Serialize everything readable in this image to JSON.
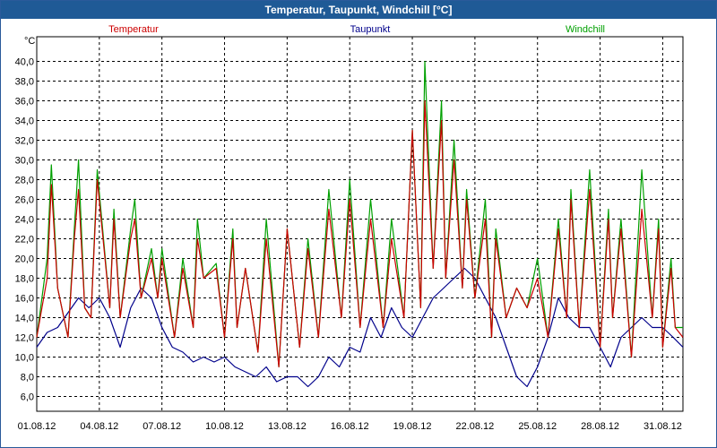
{
  "window": {
    "title": "Temperatur, Taupunkt, Windchill [°C]"
  },
  "colors": {
    "titlebar": "#1f5a96",
    "temperatur": "#cc0000",
    "taupunkt": "#00008b",
    "windchill": "#00a000"
  },
  "chart_data": {
    "type": "line",
    "title": "Temperatur, Taupunkt, Windchill [°C]",
    "ylabel": "°C",
    "xlabel": "",
    "ylim": [
      4.5,
      42.5
    ],
    "xlim": [
      0,
      30.97
    ],
    "x_start_label": "01.08.12",
    "grid": true,
    "legend_placement": "top",
    "yticks": [
      "6,0",
      "8,0",
      "10,0",
      "12,0",
      "14,0",
      "16,0",
      "18,0",
      "20,0",
      "22,0",
      "24,0",
      "26,0",
      "28,0",
      "30,0",
      "32,0",
      "34,0",
      "36,0",
      "38,0",
      "40,0"
    ],
    "ytick_values": [
      6,
      8,
      10,
      12,
      14,
      16,
      18,
      20,
      22,
      24,
      26,
      28,
      30,
      32,
      34,
      36,
      38,
      40
    ],
    "xticks": [
      "01.08.12",
      "04.08.12",
      "07.08.12",
      "10.08.12",
      "13.08.12",
      "16.08.12",
      "19.08.12",
      "22.08.12",
      "25.08.12",
      "28.08.12",
      "31.08.12"
    ],
    "xtick_values": [
      0,
      3,
      6,
      9,
      12,
      15,
      18,
      21,
      24,
      27,
      30
    ],
    "series": [
      {
        "name": "Temperatur",
        "color": "#cc0000",
        "x": [
          0,
          0.5,
          0.7,
          1,
          1.5,
          1.8,
          2,
          2.3,
          2.6,
          2.9,
          3.5,
          3.7,
          4,
          4.5,
          4.7,
          5,
          5.5,
          5.8,
          6,
          6.6,
          7,
          7.5,
          7.7,
          8,
          8.6,
          9,
          9.4,
          9.6,
          10,
          10.6,
          11,
          11.6,
          12,
          12.6,
          13,
          13.5,
          14,
          14.6,
          15,
          15.5,
          16,
          16.6,
          17,
          17.6,
          18,
          18.4,
          18.6,
          19,
          19.4,
          19.6,
          20,
          20.4,
          20.6,
          21,
          21.5,
          21.8,
          22,
          22.5,
          23,
          23.5,
          24,
          24.5,
          25,
          25.4,
          25.6,
          26,
          26.5,
          27,
          27.4,
          27.6,
          28,
          28.5,
          29,
          29.5,
          29.8,
          30,
          30.4,
          30.6,
          30.97
        ],
        "y": [
          12,
          18,
          27.5,
          17,
          12,
          22,
          27,
          15,
          14,
          28,
          15,
          24,
          14,
          22,
          24,
          16,
          20,
          16,
          20,
          12,
          19,
          13,
          22,
          18,
          19,
          12,
          22,
          13,
          19,
          10.5,
          22,
          9,
          23,
          11,
          21,
          12,
          25,
          14,
          26,
          13,
          24,
          13,
          22,
          14,
          33,
          15,
          36,
          19,
          34,
          18,
          30,
          17,
          26,
          16,
          24,
          12,
          22,
          14,
          17,
          15,
          18,
          12,
          23,
          14,
          26,
          13,
          27,
          11,
          24,
          14,
          23,
          10,
          25,
          14,
          23,
          11,
          19,
          13,
          12
        ]
      },
      {
        "name": "Taupunkt",
        "color": "#00008b",
        "x": [
          0,
          0.5,
          1,
          1.5,
          2,
          2.5,
          3,
          3.5,
          4,
          4.5,
          5,
          5.5,
          6,
          6.5,
          7,
          7.5,
          8,
          8.5,
          9,
          9.5,
          10,
          10.5,
          11,
          11.5,
          12,
          12.5,
          13,
          13.5,
          14,
          14.5,
          15,
          15.5,
          16,
          16.5,
          17,
          17.5,
          18,
          18.5,
          19,
          19.5,
          20,
          20.5,
          21,
          21.5,
          22,
          22.5,
          23,
          23.5,
          24,
          24.5,
          25,
          25.5,
          26,
          26.5,
          27,
          27.5,
          28,
          28.5,
          29,
          29.5,
          30,
          30.5,
          30.97
        ],
        "y": [
          11,
          12.5,
          13,
          14.5,
          16,
          15,
          16,
          14,
          11,
          15,
          17,
          16,
          13,
          11,
          10.5,
          9.5,
          10,
          9.5,
          10,
          9,
          8.5,
          8,
          9,
          7.5,
          8,
          8,
          7,
          8,
          10,
          9,
          11,
          10.5,
          14,
          12,
          15,
          13,
          12,
          14,
          16,
          17,
          18,
          19,
          18,
          16,
          14,
          11,
          8,
          7,
          9,
          12,
          16,
          14,
          13,
          13,
          11,
          9,
          12,
          13,
          14,
          13,
          13,
          12,
          11
        ]
      },
      {
        "name": "Windchill",
        "color": "#00a000",
        "x": [
          0,
          0.5,
          0.7,
          1,
          1.5,
          1.8,
          2,
          2.3,
          2.6,
          2.9,
          3.5,
          3.7,
          4,
          4.5,
          4.7,
          5,
          5.5,
          5.8,
          6,
          6.6,
          7,
          7.5,
          7.7,
          8,
          8.6,
          9,
          9.4,
          9.6,
          10,
          10.6,
          11,
          11.6,
          12,
          12.6,
          13,
          13.5,
          14,
          14.6,
          15,
          15.5,
          16,
          16.6,
          17,
          17.6,
          18,
          18.4,
          18.6,
          19,
          19.4,
          19.6,
          20,
          20.4,
          20.6,
          21,
          21.5,
          21.8,
          22,
          22.5,
          23,
          23.5,
          24,
          24.5,
          25,
          25.4,
          25.6,
          26,
          26.5,
          27,
          27.4,
          27.6,
          28,
          28.5,
          29,
          29.5,
          29.8,
          30,
          30.4,
          30.6,
          30.97
        ],
        "y": [
          12,
          20,
          29.5,
          17,
          12,
          23,
          30,
          15,
          14,
          29,
          15,
          25,
          14,
          23,
          26,
          16,
          21,
          16,
          21,
          12,
          20,
          13,
          24,
          18,
          19.5,
          12,
          23,
          13,
          19,
          10.5,
          24,
          9,
          23,
          11,
          22,
          12,
          27,
          14,
          28,
          13,
          26,
          13,
          24,
          14,
          33,
          15,
          40,
          19,
          36,
          18,
          32,
          17,
          27,
          16,
          26,
          12,
          23,
          14,
          17,
          15,
          20,
          12,
          24,
          14,
          27,
          13,
          29,
          11,
          25,
          14,
          24,
          10,
          29,
          14,
          24,
          11,
          20,
          13,
          13
        ]
      }
    ]
  }
}
